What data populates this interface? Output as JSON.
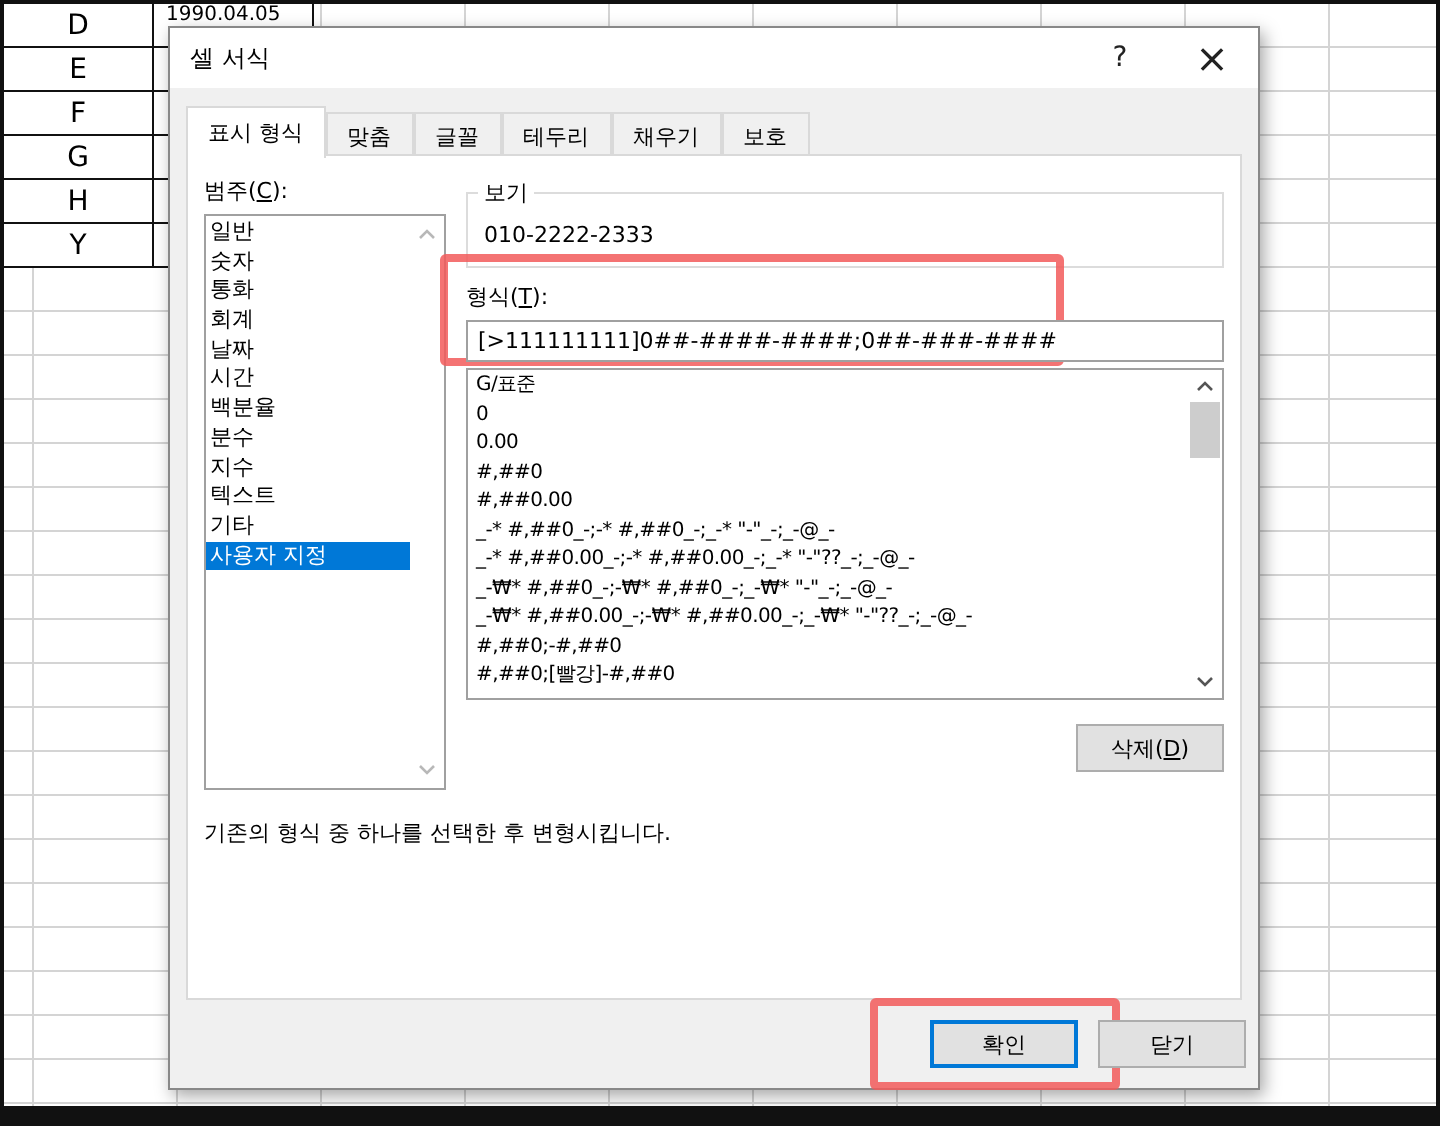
{
  "sheet": {
    "rows": [
      {
        "label": "D",
        "value": "1990.04.05"
      },
      {
        "label": "E",
        "value": ""
      },
      {
        "label": "F",
        "value": ""
      },
      {
        "label": "G",
        "value": ""
      },
      {
        "label": "H",
        "value": ""
      },
      {
        "label": "Y",
        "value": ""
      }
    ]
  },
  "dialog": {
    "title": "셀 서식",
    "help": "?",
    "close": "×",
    "tabs": [
      {
        "label": "표시 형식",
        "selected": true
      },
      {
        "label": "맞춤",
        "selected": false
      },
      {
        "label": "글꼴",
        "selected": false
      },
      {
        "label": "테두리",
        "selected": false
      },
      {
        "label": "채우기",
        "selected": false
      },
      {
        "label": "보호",
        "selected": false
      }
    ],
    "category": {
      "label": {
        "before": "범주(",
        "key": "C",
        "after": "):"
      },
      "items": [
        {
          "label": "일반",
          "selected": false
        },
        {
          "label": "숫자",
          "selected": false
        },
        {
          "label": "통화",
          "selected": false
        },
        {
          "label": "회계",
          "selected": false
        },
        {
          "label": "날짜",
          "selected": false
        },
        {
          "label": "시간",
          "selected": false
        },
        {
          "label": "백분율",
          "selected": false
        },
        {
          "label": "분수",
          "selected": false
        },
        {
          "label": "지수",
          "selected": false
        },
        {
          "label": "텍스트",
          "selected": false
        },
        {
          "label": "기타",
          "selected": false
        },
        {
          "label": "사용자 지정",
          "selected": true
        }
      ]
    },
    "sample": {
      "label": "보기",
      "value": "010-2222-2333"
    },
    "format": {
      "label": {
        "before": "형식(",
        "key": "T",
        "after": "):"
      },
      "value": "[>111111111]0##-####-####;0##-###-####",
      "items": [
        "G/표준",
        "0",
        "0.00",
        "#,##0",
        "#,##0.00",
        "_-* #,##0_-;-* #,##0_-;_-* \"-\"_-;_-@_-",
        "_-* #,##0.00_-;-* #,##0.00_-;_-* \"-\"??_-;_-@_-",
        "_-₩* #,##0_-;-₩* #,##0_-;_-₩* \"-\"_-;_-@_-",
        "_-₩* #,##0.00_-;-₩* #,##0.00_-;_-₩* \"-\"??_-;_-@_-",
        "#,##0;-#,##0",
        "#,##0;[빨강]-#,##0"
      ]
    },
    "delete_button": {
      "before": "삭제(",
      "key": "D",
      "after": ")"
    },
    "description": "기존의 형식 중 하나를 선택한 후 변형시킵니다.",
    "buttons": [
      {
        "label": "확인",
        "default": true
      },
      {
        "label": "닫기",
        "default": false
      }
    ]
  },
  "annotations": [
    {
      "kind": "highlight"
    },
    {
      "kind": "highlight"
    }
  ]
}
